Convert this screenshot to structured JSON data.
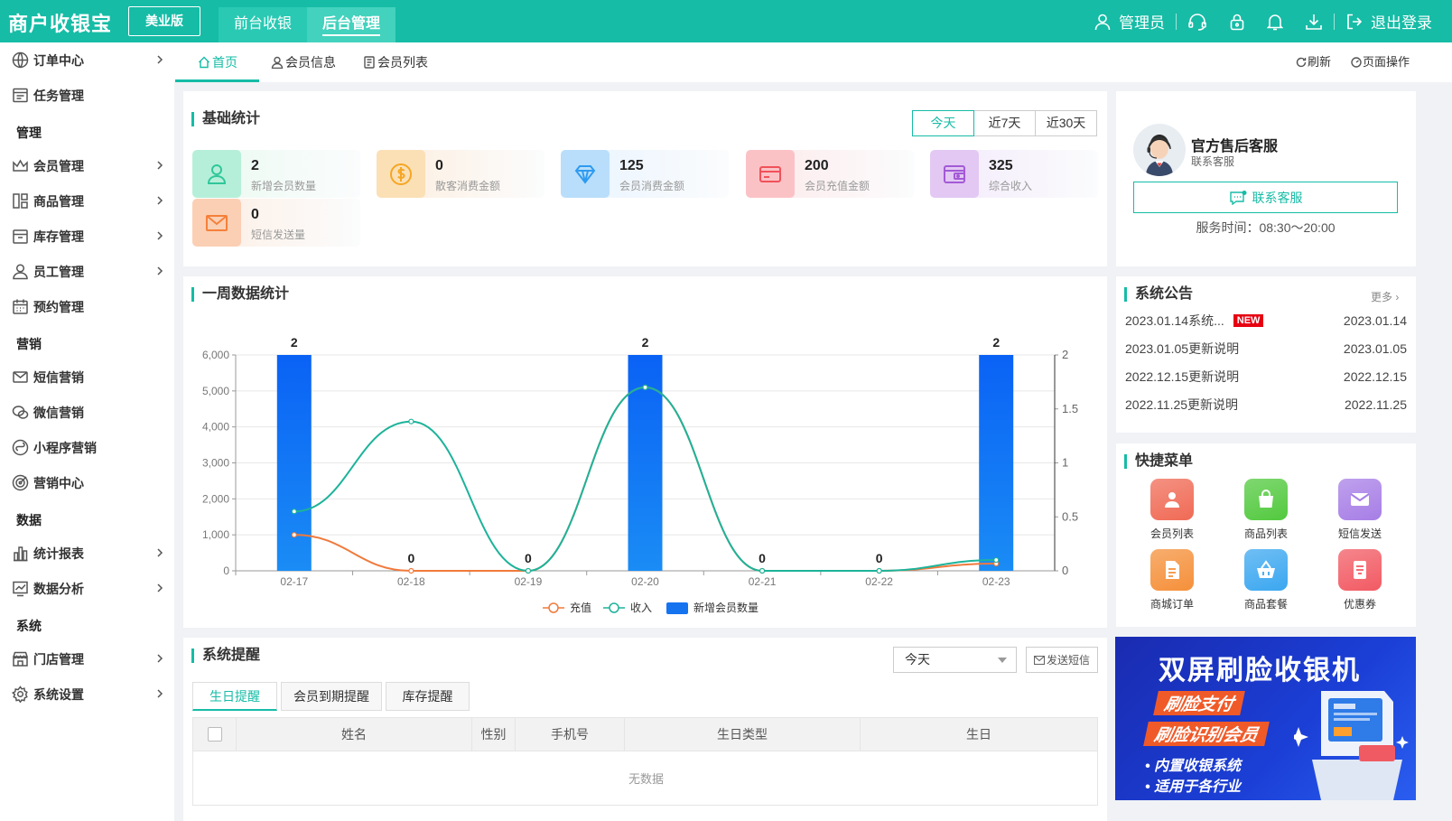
{
  "app": {
    "logo": "商户收银宝",
    "edition": "美业版"
  },
  "topnav": [
    {
      "label": "前台收银",
      "active": false
    },
    {
      "label": "后台管理",
      "active": true
    }
  ],
  "header_right": {
    "user": "管理员",
    "logout": "退出登录"
  },
  "sidebar": {
    "items": [
      {
        "label": "订单中心",
        "icon": "globe-icon",
        "chevron": true
      },
      {
        "label": "任务管理",
        "icon": "task-icon",
        "chevron": false
      },
      {
        "group": "管理"
      },
      {
        "label": "会员管理",
        "icon": "crown-icon",
        "chevron": true
      },
      {
        "label": "商品管理",
        "icon": "layout-icon",
        "chevron": true
      },
      {
        "label": "库存管理",
        "icon": "box-icon",
        "chevron": true
      },
      {
        "label": "员工管理",
        "icon": "user-icon",
        "chevron": true
      },
      {
        "label": "预约管理",
        "icon": "calendar-icon",
        "chevron": false
      },
      {
        "group": "营销"
      },
      {
        "label": "短信营销",
        "icon": "mail-icon",
        "chevron": false
      },
      {
        "label": "微信营销",
        "icon": "wechat-icon",
        "chevron": false
      },
      {
        "label": "小程序营销",
        "icon": "miniapp-icon",
        "chevron": false
      },
      {
        "label": "营销中心",
        "icon": "target-icon",
        "chevron": false
      },
      {
        "group": "数据"
      },
      {
        "label": "统计报表",
        "icon": "bar-chart-icon",
        "chevron": true
      },
      {
        "label": "数据分析",
        "icon": "line-chart-icon",
        "chevron": true
      },
      {
        "group": "系统"
      },
      {
        "label": "门店管理",
        "icon": "store-icon",
        "chevron": true
      },
      {
        "label": "系统设置",
        "icon": "gear-icon",
        "chevron": true
      }
    ]
  },
  "tabs": [
    {
      "label": "首页",
      "active": true
    },
    {
      "label": "会员信息",
      "active": false
    },
    {
      "label": "会员列表",
      "active": false
    }
  ],
  "tab_actions": {
    "refresh": "刷新",
    "page_ops": "页面操作"
  },
  "basic_stats": {
    "title": "基础统计",
    "ranges": [
      {
        "label": "今天",
        "active": true
      },
      {
        "label": "近7天",
        "active": false
      },
      {
        "label": "近30天",
        "active": false
      }
    ],
    "cards": [
      {
        "value": "2",
        "label": "新增会员数量",
        "color": "#2fc79a"
      },
      {
        "value": "0",
        "label": "散客消费金额",
        "color": "#f5a623"
      },
      {
        "value": "125",
        "label": "会员消费金额",
        "color": "#2e9bf0"
      },
      {
        "value": "200",
        "label": "会员充值金额",
        "color": "#f0525a"
      },
      {
        "value": "325",
        "label": "综合收入",
        "color": "#a35ad6"
      },
      {
        "value": "0",
        "label": "短信发送量",
        "color": "#f5803a"
      }
    ]
  },
  "service": {
    "name": "官方售后客服",
    "sub": "联系客服",
    "button": "联系客服",
    "hours": "服务时间：08:30～20:00"
  },
  "weekly": {
    "title": "一周数据统计"
  },
  "chart_data": {
    "type": "bar",
    "categories": [
      "02-17",
      "02-18",
      "02-19",
      "02-20",
      "02-21",
      "02-22",
      "02-23"
    ],
    "series": [
      {
        "name": "充值",
        "type": "line",
        "axis": "left",
        "values": [
          1000,
          0,
          0,
          5100,
          0,
          0,
          200
        ],
        "color": "#f07a3c"
      },
      {
        "name": "收入",
        "type": "line",
        "axis": "left",
        "values": [
          1650,
          4150,
          0,
          5100,
          0,
          0,
          300
        ],
        "color": "#1db39a"
      },
      {
        "name": "新增会员数量",
        "type": "bar",
        "axis": "right",
        "values": [
          2,
          0,
          0,
          2,
          0,
          0,
          2
        ],
        "color": "#1673f0"
      }
    ],
    "yleft": {
      "min": 0,
      "max": 6000,
      "ticks": [
        "0",
        "1,000",
        "2,000",
        "3,000",
        "4,000",
        "5,000",
        "6,000"
      ]
    },
    "yright": {
      "min": 0,
      "max": 2,
      "ticks": [
        "0",
        "0.5",
        "1",
        "1.5",
        "2"
      ]
    },
    "legend": "bottom",
    "grid": true
  },
  "notices": {
    "title": "系统公告",
    "more": "更多 ›",
    "new_badge": "NEW",
    "items": [
      {
        "title": "2023.01.14系统...",
        "date": "2023.01.14",
        "is_new": true
      },
      {
        "title": "2023.01.05更新说明",
        "date": "2023.01.05",
        "is_new": false
      },
      {
        "title": "2022.12.15更新说明",
        "date": "2022.12.15",
        "is_new": false
      },
      {
        "title": "2022.11.25更新说明",
        "date": "2022.11.25",
        "is_new": false
      }
    ]
  },
  "quick_menu": {
    "title": "快捷菜单",
    "items": [
      {
        "label": "会员列表",
        "icon": "member-icon",
        "color": "#f06a55"
      },
      {
        "label": "商品列表",
        "icon": "shopping-bag-icon",
        "color": "#52c93e"
      },
      {
        "label": "短信发送",
        "icon": "envelope-icon",
        "color": "#a77ee6"
      },
      {
        "label": "商城订单",
        "icon": "order-icon",
        "color": "#f5903a"
      },
      {
        "label": "商品套餐",
        "icon": "basket-icon",
        "color": "#3ba7f0"
      },
      {
        "label": "优惠券",
        "icon": "coupon-icon",
        "color": "#f25a63"
      }
    ]
  },
  "banner": {
    "title": "双屏刷脸收银机",
    "tag1": "刷脸支付",
    "tag2": "刷脸识别会员",
    "b1": "• 内置收银系统",
    "b2": "• 适用于各行业"
  },
  "reminders": {
    "title": "系统提醒",
    "select": "今天",
    "send": "发送短信",
    "tabs": [
      {
        "label": "生日提醒",
        "active": true
      },
      {
        "label": "会员到期提醒",
        "active": false
      },
      {
        "label": "库存提醒",
        "active": false
      }
    ],
    "columns": [
      "姓名",
      "性别",
      "手机号",
      "生日类型",
      "生日"
    ],
    "empty": "无数据"
  }
}
